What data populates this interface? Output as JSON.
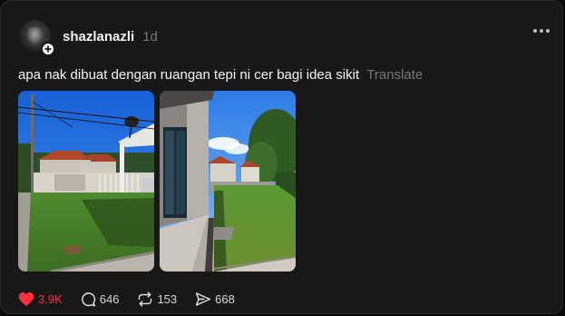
{
  "post": {
    "username": "shazlanazli",
    "time": "1d",
    "caption": "apa nak dibuat dengan ruangan tepi ni cer bagi idea sikit",
    "translate_label": "Translate"
  },
  "actions": {
    "likes": "3.9K",
    "comments": "646",
    "reposts": "153",
    "shares": "668"
  },
  "colors": {
    "like_active": "#ff3040",
    "muted_text": "#777777",
    "card_bg": "#181818"
  }
}
